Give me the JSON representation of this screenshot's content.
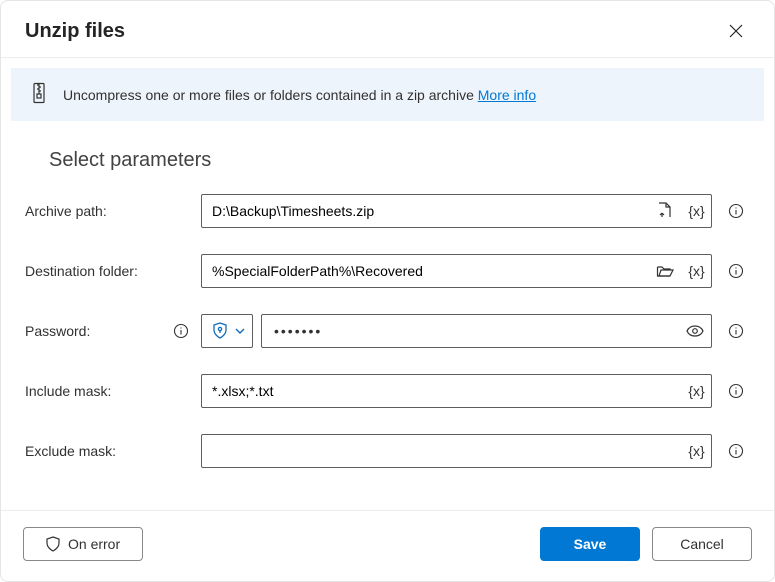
{
  "dialog": {
    "title": "Unzip files"
  },
  "banner": {
    "text": "Uncompress one or more files or folders contained in a zip archive ",
    "more_info": "More info"
  },
  "section": {
    "title": "Select parameters"
  },
  "fields": {
    "archive": {
      "label": "Archive path:",
      "value": "D:\\Backup\\Timesheets.zip"
    },
    "destination": {
      "label": "Destination folder:",
      "value": "%SpecialFolderPath%\\Recovered"
    },
    "password": {
      "label": "Password:",
      "value": "•••••••"
    },
    "include": {
      "label": "Include mask:",
      "value": "*.xlsx;*.txt"
    },
    "exclude": {
      "label": "Exclude mask:",
      "value": ""
    },
    "var_token": "{x}"
  },
  "footer": {
    "on_error": "On error",
    "save": "Save",
    "cancel": "Cancel"
  }
}
